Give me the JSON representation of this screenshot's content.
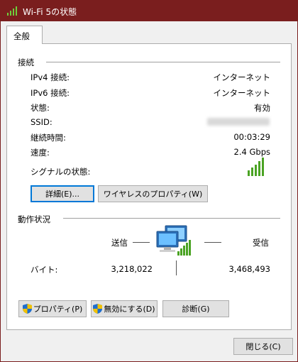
{
  "window": {
    "title": "Wi-Fi 5の状態"
  },
  "tabs": [
    {
      "label": "全般"
    }
  ],
  "connection": {
    "section_title": "接続",
    "rows": [
      {
        "label": "IPv4 接続:",
        "value": "インターネット"
      },
      {
        "label": "IPv6 接続:",
        "value": "インターネット"
      },
      {
        "label": "状態:",
        "value": "有効"
      },
      {
        "label": "SSID:",
        "value": ""
      },
      {
        "label": "継続時間:",
        "value": "00:03:29"
      },
      {
        "label": "速度:",
        "value": "2.4 Gbps"
      }
    ],
    "signal_label": "シグナルの状態:",
    "signal_level": "5/5",
    "details_button": "詳細(E)...",
    "wireless_props_button": "ワイヤレスのプロパティ(W)"
  },
  "activity": {
    "section_title": "動作状況",
    "sent_label": "送信",
    "received_label": "受信",
    "bytes_label": "バイト:",
    "bytes_sent": "3,218,022",
    "bytes_received": "3,468,493"
  },
  "actions": {
    "properties_button": "プロパティ(P)",
    "disable_button": "無効にする(D)",
    "diagnose_button": "診断(G)"
  },
  "footer": {
    "close_button": "閉じる(C)"
  },
  "colors": {
    "titlebar": "#7a1e1e",
    "signal": "#4aa323",
    "default_button_border": "#0078d7"
  },
  "icons": [
    "wifi-signal-icon",
    "network-computers-icon",
    "shield-icon"
  ]
}
